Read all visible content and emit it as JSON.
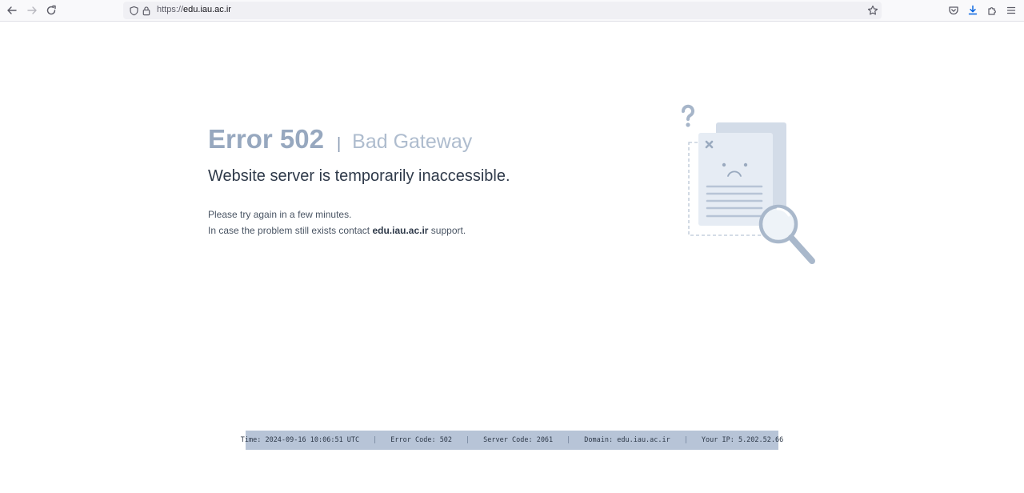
{
  "browser": {
    "url_protocol": "https://",
    "url_host": "edu.iau.ac.ir"
  },
  "error": {
    "code_label": "Error 502",
    "separator": "|",
    "name": "Bad Gateway",
    "headline": "Website server is temporarily inaccessible.",
    "line1": "Please try again in a few minutes.",
    "line2_prefix": "In case the problem still exists contact ",
    "line2_domain": "edu.iau.ac.ir",
    "line2_suffix": " support."
  },
  "info": {
    "time": "Time: 2024-09-16 10:06:51 UTC",
    "error_code": "Error Code: 502",
    "server_code": "Server Code: 2061",
    "domain": "Domain: edu.iau.ac.ir",
    "ip": "Your IP: 5.202.52.66",
    "pipe": "|"
  },
  "icons": {
    "back": "arrow-left-icon",
    "forward": "arrow-right-icon",
    "reload": "reload-icon",
    "shield": "shield-icon",
    "lock": "lock-icon",
    "bookmark": "star-icon",
    "pocket": "pocket-icon",
    "downloads": "download-icon",
    "extensions": "puzzle-icon",
    "menu": "hamburger-menu-icon"
  },
  "colors": {
    "accent_muted": "#97a8bf",
    "info_bar": "#b7c4d7",
    "text_dark": "#2f3a4a"
  }
}
